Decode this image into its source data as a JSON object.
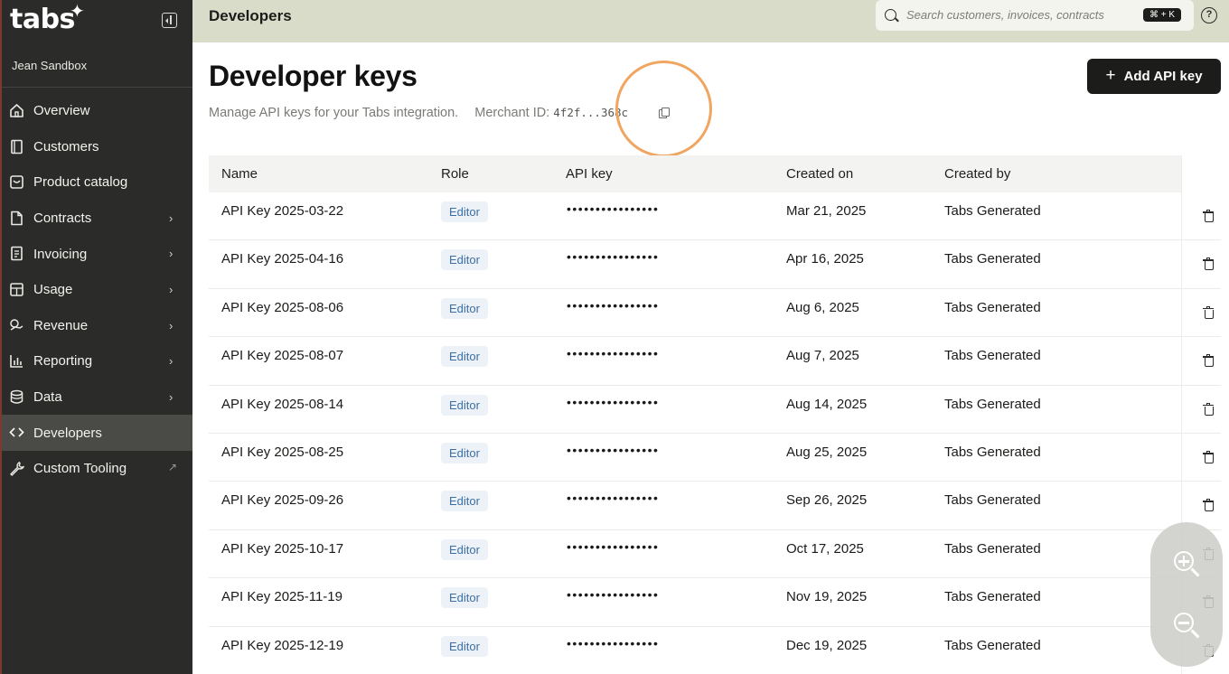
{
  "app": {
    "logo": "tabs",
    "workspace": "Jean Sandbox"
  },
  "sidebar": {
    "items": [
      {
        "label": "Overview",
        "icon": "home-icon",
        "has_submenu": false
      },
      {
        "label": "Customers",
        "icon": "book-icon",
        "has_submenu": false
      },
      {
        "label": "Product catalog",
        "icon": "box-icon",
        "has_submenu": false
      },
      {
        "label": "Contracts",
        "icon": "file-icon",
        "has_submenu": true
      },
      {
        "label": "Invoicing",
        "icon": "receipt-icon",
        "has_submenu": true
      },
      {
        "label": "Usage",
        "icon": "grid-icon",
        "has_submenu": true
      },
      {
        "label": "Revenue",
        "icon": "coins-icon",
        "has_submenu": true
      },
      {
        "label": "Reporting",
        "icon": "bar-chart-icon",
        "has_submenu": true
      },
      {
        "label": "Data",
        "icon": "database-icon",
        "has_submenu": true
      },
      {
        "label": "Developers",
        "icon": "code-icon",
        "has_submenu": false,
        "active": true
      },
      {
        "label": "Custom Tooling",
        "icon": "wrench-icon",
        "has_submenu": false,
        "external": true
      }
    ]
  },
  "header": {
    "title": "Developers",
    "search_placeholder": "Search customers, invoices, contracts",
    "search_shortcut": "⌘ + K",
    "help_glyph": "?"
  },
  "page": {
    "title": "Developer keys",
    "subtitle": "Manage API keys for your Tabs integration.",
    "merchant_label": "Merchant ID:",
    "merchant_id": "4f2f...368c",
    "add_button_label": "Add API key",
    "add_button_glyph": "+"
  },
  "table": {
    "columns": [
      "Name",
      "Role",
      "API key",
      "Created on",
      "Created by"
    ],
    "rows": [
      {
        "name": "API Key 2025-03-22",
        "role": "Editor",
        "key": "••••••••••••••••",
        "created_on": "Mar 21, 2025",
        "created_by": "Tabs Generated"
      },
      {
        "name": "API Key 2025-04-16",
        "role": "Editor",
        "key": "••••••••••••••••",
        "created_on": "Apr 16, 2025",
        "created_by": "Tabs Generated"
      },
      {
        "name": "API Key 2025-08-06",
        "role": "Editor",
        "key": "••••••••••••••••",
        "created_on": "Aug 6, 2025",
        "created_by": "Tabs Generated"
      },
      {
        "name": "API Key 2025-08-07",
        "role": "Editor",
        "key": "••••••••••••••••",
        "created_on": "Aug 7, 2025",
        "created_by": "Tabs Generated"
      },
      {
        "name": "API Key 2025-08-14",
        "role": "Editor",
        "key": "••••••••••••••••",
        "created_on": "Aug 14, 2025",
        "created_by": "Tabs Generated"
      },
      {
        "name": "API Key 2025-08-25",
        "role": "Editor",
        "key": "••••••••••••••••",
        "created_on": "Aug 25, 2025",
        "created_by": "Tabs Generated"
      },
      {
        "name": "API Key 2025-09-26",
        "role": "Editor",
        "key": "••••••••••••••••",
        "created_on": "Sep 26, 2025",
        "created_by": "Tabs Generated"
      },
      {
        "name": "API Key 2025-10-17",
        "role": "Editor",
        "key": "••••••••••••••••",
        "created_on": "Oct 17, 2025",
        "created_by": "Tabs Generated"
      },
      {
        "name": "API Key 2025-11-19",
        "role": "Editor",
        "key": "••••••••••••••••",
        "created_on": "Nov 19, 2025",
        "created_by": "Tabs Generated"
      },
      {
        "name": "API Key 2025-12-19",
        "role": "Editor",
        "key": "••••••••••••••••",
        "created_on": "Dec 19, 2025",
        "created_by": "Tabs Generated"
      }
    ]
  },
  "colors": {
    "sidebar_bg": "#2b2b29",
    "topbar_bg": "#dadcca",
    "primary_button": "#1c1c1a",
    "role_badge_bg": "#edf2f8",
    "role_badge_text": "#3d6fa3",
    "click_ring": "#f0a561"
  }
}
